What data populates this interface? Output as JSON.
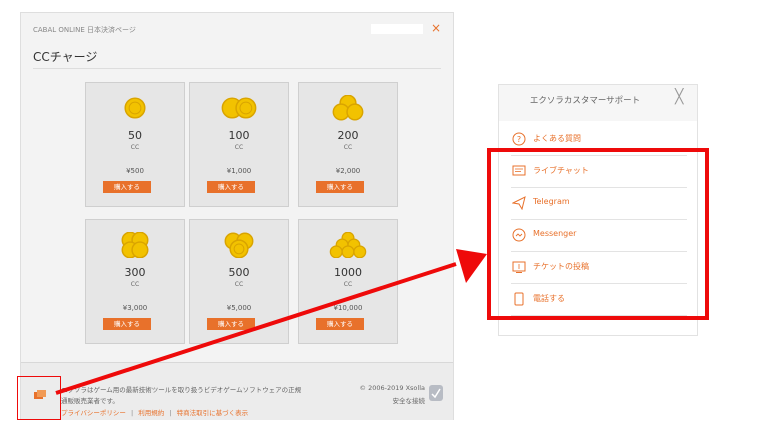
{
  "window": {
    "title": "CABAL ONLINE 日本決済ページ",
    "close_glyph": "×",
    "heading": "CCチャージ"
  },
  "packages": [
    {
      "amount": "50",
      "unit": "CC",
      "price": "¥500",
      "buy_label": "購入する",
      "coin_icon": "single-coin-icon"
    },
    {
      "amount": "100",
      "unit": "CC",
      "price": "¥1,000",
      "buy_label": "購入する",
      "coin_icon": "two-coins-icon"
    },
    {
      "amount": "200",
      "unit": "CC",
      "price": "¥2,000",
      "buy_label": "購入する",
      "coin_icon": "coin-stack-icon"
    },
    {
      "amount": "300",
      "unit": "CC",
      "price": "¥3,000",
      "buy_label": "購入する",
      "coin_icon": "coin-pile-icon"
    },
    {
      "amount": "500",
      "unit": "CC",
      "price": "¥5,000",
      "buy_label": "購入する",
      "coin_icon": "coin-pile-icon"
    },
    {
      "amount": "1000",
      "unit": "CC",
      "price": "¥10,000",
      "buy_label": "購入する",
      "coin_icon": "coin-pyramid-icon"
    }
  ],
  "footer": {
    "line1": "エクソラはゲーム用の最新技術ツールを取り扱うビデオゲームソフトウェアの正規",
    "line2": "通販販売業者です。",
    "links": [
      "プライバシーポリシー",
      "利用規約",
      "特商法取引に基づく表示"
    ],
    "link_separator": "|",
    "copyright": "© 2006-2019 Xsolla",
    "secure": "安全な接続"
  },
  "support_panel": {
    "title": "エクソラカスタマーサポート",
    "close_glyph": "╳",
    "items": [
      {
        "label": "よくある質問",
        "icon": "question-circle-icon"
      },
      {
        "label": "ライブチャット",
        "icon": "chat-bubble-icon"
      },
      {
        "label": "Telegram",
        "icon": "telegram-icon"
      },
      {
        "label": "Messenger",
        "icon": "messenger-icon"
      },
      {
        "label": "チケットの投稿",
        "icon": "ticket-icon"
      },
      {
        "label": "電話する",
        "icon": "phone-icon"
      }
    ]
  },
  "colors": {
    "accent": "#e8712b",
    "coin_gold": "#f2c200",
    "annotation_red": "#ee0a0a"
  }
}
